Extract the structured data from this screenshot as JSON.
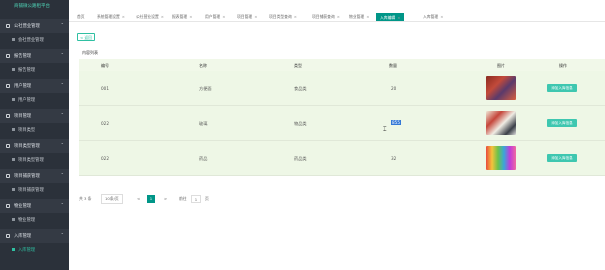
{
  "app_title": "商铺微公路租平台",
  "sidebar": {
    "sections": [
      {
        "label": "公社营业管理",
        "items": [
          {
            "label": "会社营业管理"
          }
        ]
      },
      {
        "label": "报告管理",
        "items": [
          {
            "label": "报告管理"
          }
        ]
      },
      {
        "label": "用户管理",
        "items": [
          {
            "label": "用户管理"
          }
        ]
      },
      {
        "label": "项目管理",
        "items": [
          {
            "label": "项目类型"
          }
        ]
      },
      {
        "label": "项目类型管理",
        "items": [
          {
            "label": "项目类型管理"
          }
        ]
      },
      {
        "label": "项目捕获管理",
        "items": [
          {
            "label": "项目捕获管理"
          }
        ]
      },
      {
        "label": "物业管理",
        "items": [
          {
            "label": "物业管理"
          }
        ]
      },
      {
        "label": "入库管理",
        "items": [
          {
            "label": "入库管理"
          }
        ]
      }
    ]
  },
  "tabs": [
    {
      "label": "首页"
    },
    {
      "label": "系统管理设置"
    },
    {
      "label": "公社营业设置"
    },
    {
      "label": "报表管理"
    },
    {
      "label": "用户管理"
    },
    {
      "label": "项目管理"
    },
    {
      "label": "项目类型查询"
    },
    {
      "label": "项目捕获查询"
    },
    {
      "label": "物业管理"
    },
    {
      "label": "入库编辑"
    },
    {
      "label": "入库管理"
    }
  ],
  "back_button": "< 返回",
  "panel_title": "内容列表",
  "table": {
    "headers": [
      "编号",
      "名称",
      "类型",
      "数量",
      "图片",
      "操作"
    ],
    "rows": [
      {
        "id": "001",
        "name": "方便面",
        "type": "食品类",
        "qty": "20",
        "action": "添加入库信息"
      },
      {
        "id": "022",
        "name": "玻璃",
        "type": "物品类",
        "qty": "855",
        "action": "添加入库信息"
      },
      {
        "id": "022",
        "name": "药品",
        "type": "药品类",
        "qty": "32",
        "action": "添加入库信息"
      }
    ]
  },
  "pager": {
    "total": "共 3 条",
    "page_size": "10条/页",
    "prev": "<",
    "current": "1",
    "next": ">",
    "goto_label": "前往",
    "goto_value": "1",
    "page_unit": "页"
  },
  "colors": {
    "sidebar_bg": "#2b313a",
    "accent": "#009688",
    "button": "#3ec7b0",
    "row_bg": "#eef7e6"
  }
}
